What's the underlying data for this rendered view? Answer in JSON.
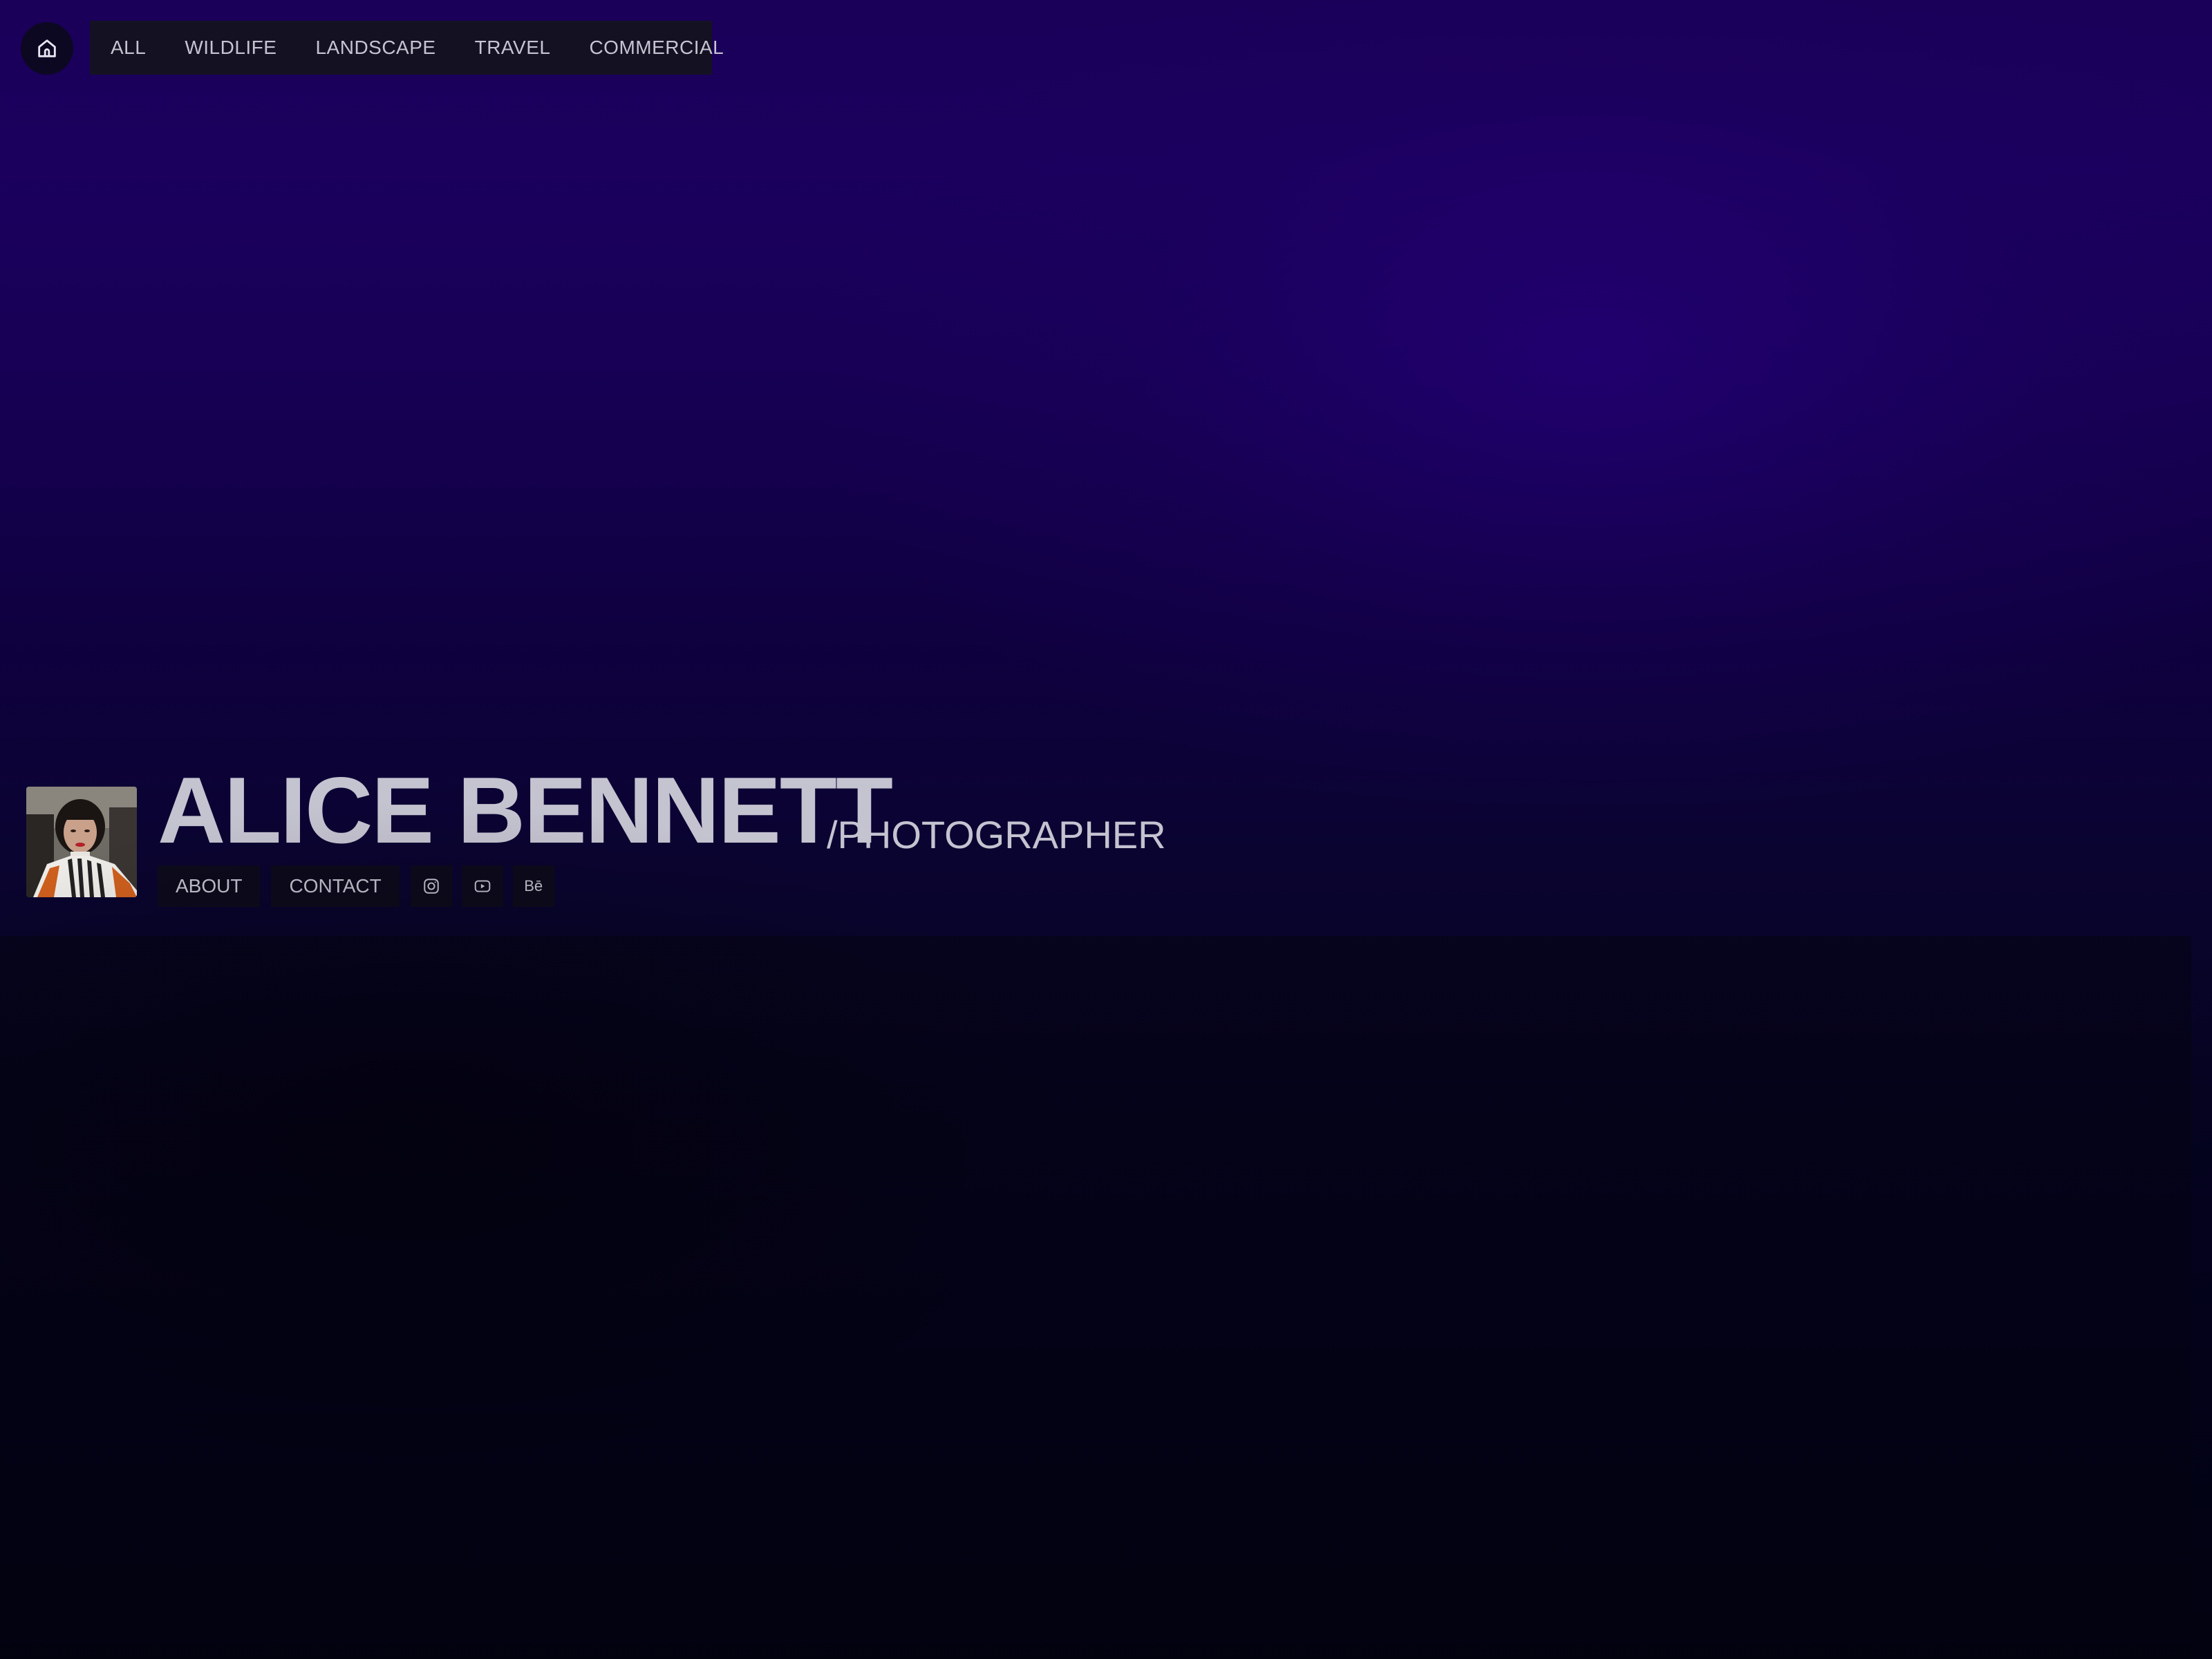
{
  "nav": {
    "home_icon": "home-icon",
    "items": [
      {
        "label": "ALL"
      },
      {
        "label": "WILDLIFE"
      },
      {
        "label": "LANDSCAPE"
      },
      {
        "label": "TRAVEL"
      },
      {
        "label": "COMMERCIAL"
      }
    ]
  },
  "hero": {
    "name": "ALICE BENNETT",
    "role": "/PHOTOGRAPHER",
    "avatar_icon": "avatar-photo"
  },
  "subnav": {
    "about": "ABOUT",
    "contact": "CONTACT",
    "instagram_icon": "instagram-icon",
    "youtube_icon": "youtube-icon",
    "behance_label": "Bē"
  },
  "colors": {
    "text": "#c4c3d0",
    "nav_bg": "#141222",
    "button_bg": "#0d0b1c",
    "bg_top": "#1a0058",
    "bg_bottom": "#020210"
  }
}
